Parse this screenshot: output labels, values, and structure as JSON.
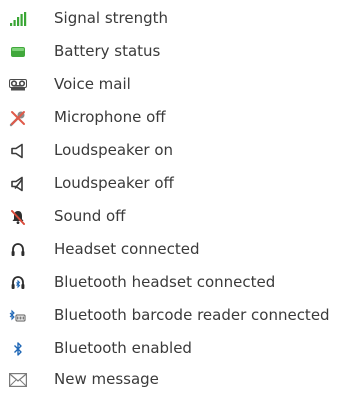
{
  "legend": {
    "items": [
      {
        "icon": "signal-strength-icon",
        "label": "Signal strength"
      },
      {
        "icon": "battery-status-icon",
        "label": "Battery status"
      },
      {
        "icon": "voice-mail-icon",
        "label": "Voice mail"
      },
      {
        "icon": "microphone-off-icon",
        "label": "Microphone off"
      },
      {
        "icon": "loudspeaker-on-icon",
        "label": "Loudspeaker on"
      },
      {
        "icon": "loudspeaker-off-icon",
        "label": "Loudspeaker off"
      },
      {
        "icon": "sound-off-icon",
        "label": "Sound off"
      },
      {
        "icon": "headset-connected-icon",
        "label": "Headset connected"
      },
      {
        "icon": "bluetooth-headset-connected-icon",
        "label": "Bluetooth headset connected"
      },
      {
        "icon": "bluetooth-barcode-reader-connected-icon",
        "label": "Bluetooth barcode reader connected"
      },
      {
        "icon": "bluetooth-enabled-icon",
        "label": "Bluetooth enabled"
      },
      {
        "icon": "new-message-icon",
        "label": "New message"
      }
    ]
  },
  "colors": {
    "signal_green": "#3aa635",
    "battery_green": "#41a83c",
    "icon_dark": "#4a4a4a",
    "mute_red": "#e05a4a",
    "bluetooth_blue": "#1f67b6"
  }
}
